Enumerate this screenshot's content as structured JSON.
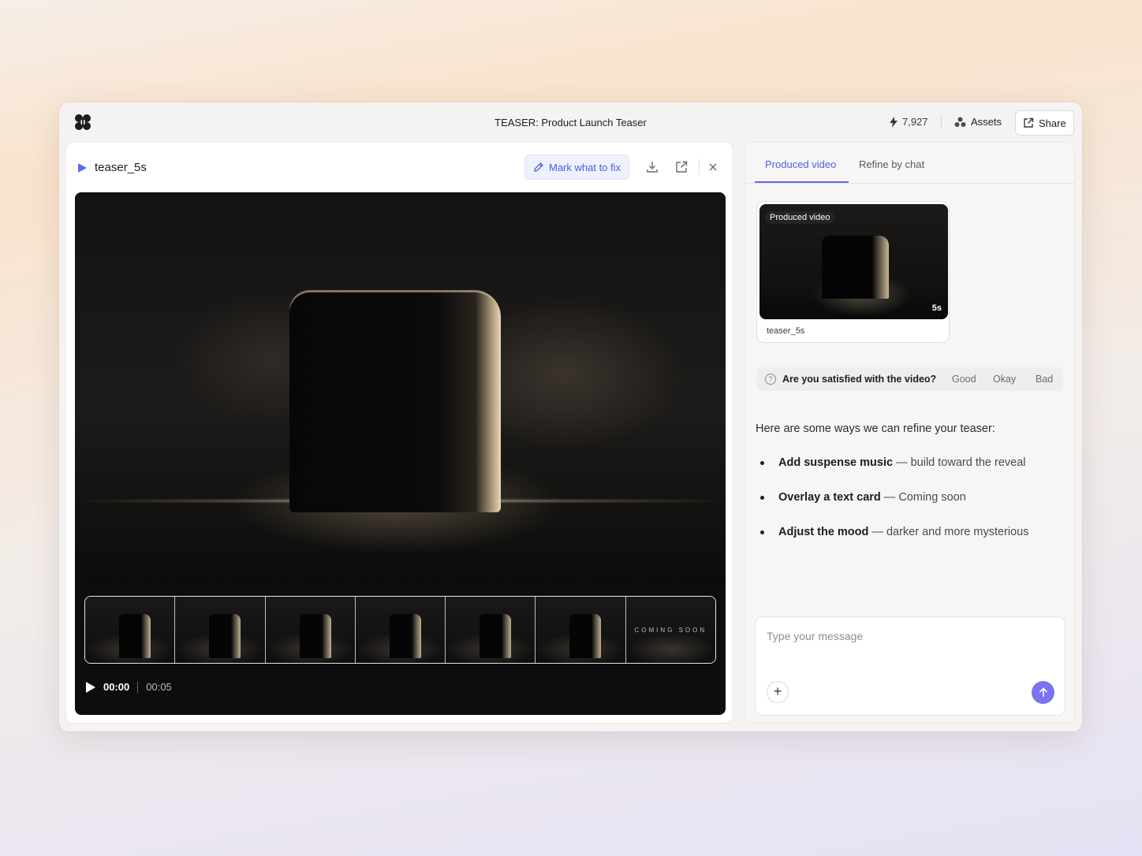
{
  "app": {
    "title": "TEASER: Product Launch Teaser"
  },
  "header": {
    "credits": "7,927",
    "assets_label": "Assets",
    "share_label": "Share"
  },
  "player": {
    "file_name": "teaser_5s",
    "mark_label": "Mark what to fix",
    "current_time": "00:00",
    "duration": "00:05",
    "end_card_text": "COMING SOON"
  },
  "tabs": [
    {
      "label": "Produced video",
      "active": true
    },
    {
      "label": "Refine by chat",
      "active": false
    }
  ],
  "produced_card": {
    "tag": "Produced video",
    "duration": "5s",
    "name": "teaser_5s"
  },
  "feedback": {
    "question": "Are you satisfied with the video?",
    "options": [
      "Good",
      "Okay",
      "Bad"
    ]
  },
  "suggestions": {
    "intro": "Here are some ways we can refine your teaser:",
    "items": [
      {
        "title": "Add suspense music",
        "detail": " — build toward the reveal"
      },
      {
        "title": "Overlay a text card",
        "detail": " — Coming soon"
      },
      {
        "title": "Adjust the mood",
        "detail": " — darker and more mysterious"
      }
    ]
  },
  "composer": {
    "placeholder": "Type your message"
  },
  "colors": {
    "accent": "#5b6cf0",
    "send": "#7b74f0"
  }
}
